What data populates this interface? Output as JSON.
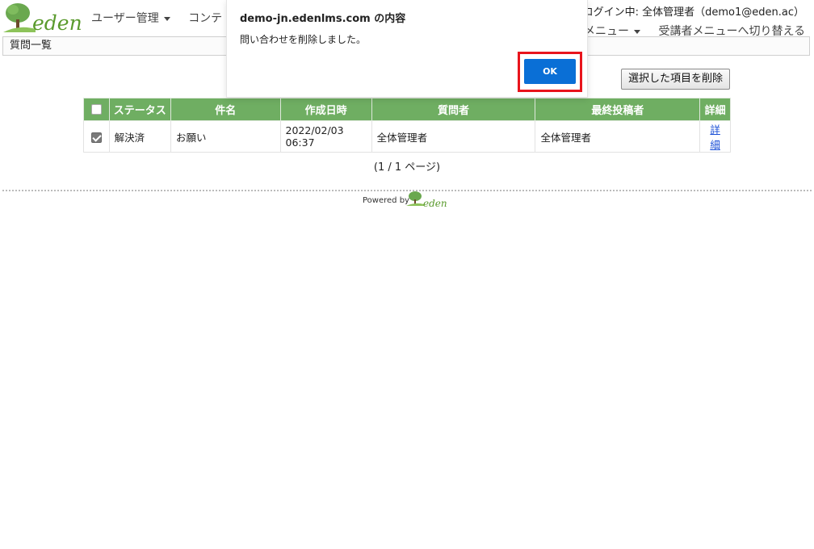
{
  "header": {
    "brand": "eden",
    "nav": [
      "ユーザー管理",
      "コンテ"
    ],
    "login_info": "ログイン中: 全体管理者（demo1@eden.ac）",
    "right_nav": [
      "メニュー",
      "受講者メニューへ切り替える"
    ]
  },
  "page": {
    "title": "質問一覧",
    "delete_button": "選択した項目を削除",
    "pagination": "(1 / 1 ページ)"
  },
  "table": {
    "columns": [
      "ステータス",
      "件名",
      "作成日時",
      "質問者",
      "最終投稿者",
      "詳細"
    ],
    "rows": [
      {
        "checked": true,
        "status": "解決済",
        "subject": "お願い",
        "created": "2022/02/03 06:37",
        "questioner": "全体管理者",
        "last_poster": "全体管理者",
        "detail": "詳細"
      }
    ]
  },
  "footer": {
    "powered_by": "Powered by",
    "brand": "eden"
  },
  "dialog": {
    "title": "demo-jn.edenlms.com の内容",
    "message": "問い合わせを削除しました。",
    "ok_label": "OK"
  },
  "colors": {
    "header_green": "#6fae62",
    "ok_blue": "#0a6fd6",
    "highlight_red": "#e8141c",
    "brand_green": "#5a9a2d"
  }
}
